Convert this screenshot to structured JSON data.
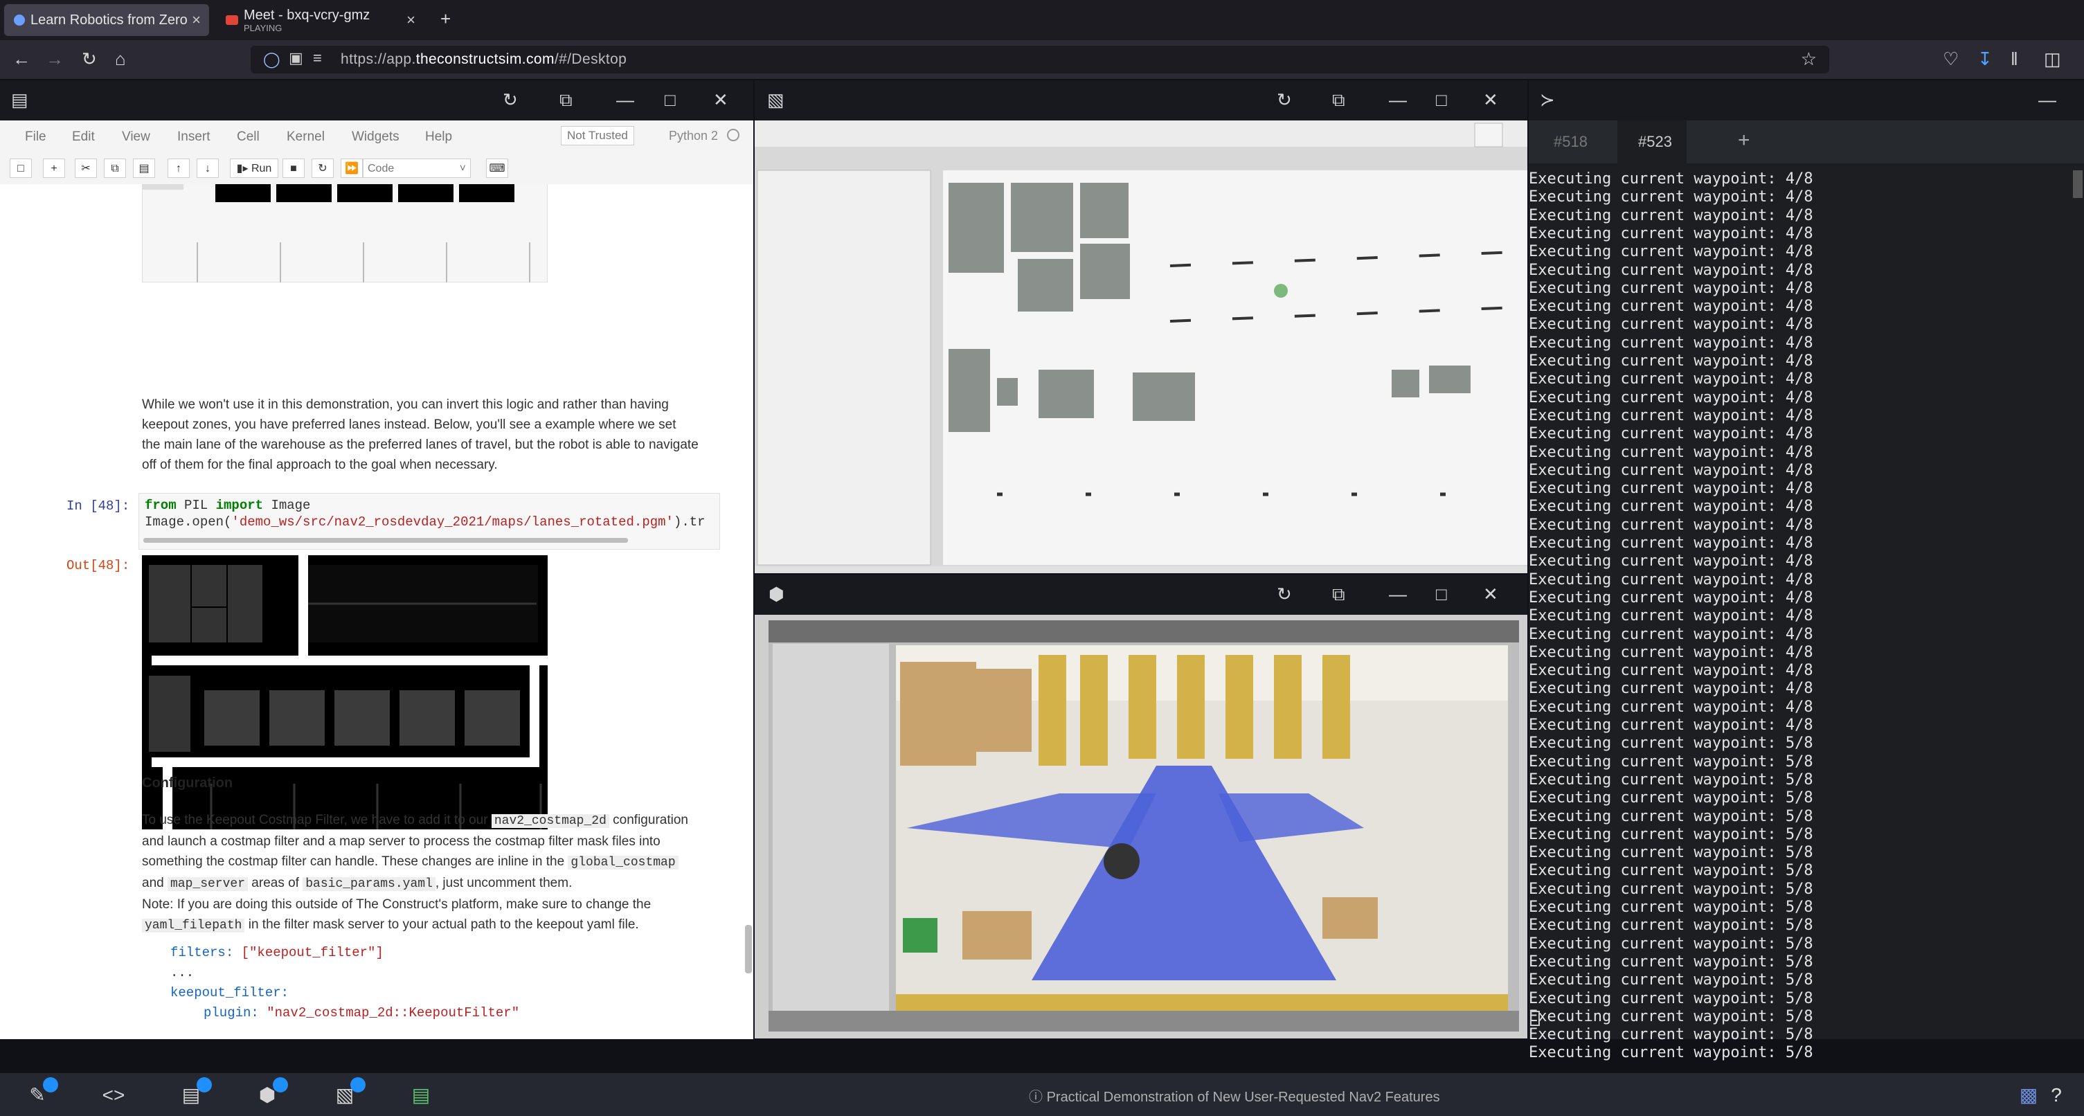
{
  "browser": {
    "tabs": [
      {
        "title": "Learn Robotics from Zero",
        "close": "×"
      },
      {
        "title": "Meet - bxq-vcry-gmz",
        "subtitle": "PLAYING",
        "close": "×"
      }
    ],
    "new_tab": "+",
    "url_prefix": "https://app.",
    "url_domain": "theconstructsim.com",
    "url_suffix": "/#/Desktop"
  },
  "jupyter": {
    "menu": [
      "File",
      "Edit",
      "View",
      "Insert",
      "Cell",
      "Kernel",
      "Widgets",
      "Help"
    ],
    "trust_label": "Not Trusted",
    "kernel_label": "Python 2",
    "run_label": "Run",
    "cell_type": "Code",
    "para1": [
      "While we won't use it in this demonstration, you can invert this logic and rather than having",
      "keepout zones, you have preferred lanes instead. Below, you'll see a example where we set",
      "the main lane of the warehouse as the preferred lanes of travel, but the robot is able to navigate",
      "off of them for the final approach to the goal when necessary."
    ],
    "in_prompt": "In [48]:",
    "out_prompt": "Out[48]:",
    "code_line1_kw1": "from",
    "code_line1_mid": " PIL ",
    "code_line1_kw2": "import",
    "code_line1_end": " Image",
    "code_line2_start": "Image.open(",
    "code_line2_str": "'demo_ws/src/nav2_rosdevday_2021/maps/lanes_rotated.pgm'",
    "code_line2_end": ").tr",
    "config_heading": "Configuration",
    "para2_a": "To use the Keepout Costmap Filter, we have to add it to our",
    "para2_code1": "nav2_costmap_2d",
    "para2_b": "configuration",
    "para2_line2": "and launch a costmap filter and a map server to process the costmap filter mask files into",
    "para2_c": "something the costmap filter can handle. These changes are inline in the",
    "para2_code2": "global_costmap",
    "para2_d": "and",
    "para2_code3": "map_server",
    "para2_e": "areas of",
    "para2_code4": "basic_params.yaml",
    "para2_f": ", just uncomment them.",
    "note_a": "Note: If you are doing this outside of The Construct's platform, make sure to change the",
    "note_code": "yaml_filepath",
    "note_b": "in the filter mask server to your actual path to the keepout yaml file.",
    "yaml_line1_key": "filters:",
    "yaml_line1_val": " [\"keepout_filter\"]",
    "yaml_line2": "...",
    "yaml_line3": "keepout_filter:",
    "yaml_line4_key": "plugin:",
    "yaml_line4_val": " \"nav2_costmap_2d::KeepoutFilter\""
  },
  "terminal": {
    "tabs": [
      "#518",
      "#523"
    ],
    "add_tab": "+",
    "lines": [
      "Executing current waypoint: 4/8",
      "Executing current waypoint: 4/8",
      "Executing current waypoint: 4/8",
      "Executing current waypoint: 4/8",
      "Executing current waypoint: 4/8",
      "Executing current waypoint: 4/8",
      "Executing current waypoint: 4/8",
      "Executing current waypoint: 4/8",
      "Executing current waypoint: 4/8",
      "Executing current waypoint: 4/8",
      "Executing current waypoint: 4/8",
      "Executing current waypoint: 4/8",
      "Executing current waypoint: 4/8",
      "Executing current waypoint: 4/8",
      "Executing current waypoint: 4/8",
      "Executing current waypoint: 4/8",
      "Executing current waypoint: 4/8",
      "Executing current waypoint: 4/8",
      "Executing current waypoint: 4/8",
      "Executing current waypoint: 4/8",
      "Executing current waypoint: 4/8",
      "Executing current waypoint: 4/8",
      "Executing current waypoint: 4/8",
      "Executing current waypoint: 4/8",
      "Executing current waypoint: 4/8",
      "Executing current waypoint: 4/8",
      "Executing current waypoint: 4/8",
      "Executing current waypoint: 4/8",
      "Executing current waypoint: 4/8",
      "Executing current waypoint: 4/8",
      "Executing current waypoint: 4/8",
      "Executing current waypoint: 5/8",
      "Executing current waypoint: 5/8",
      "Executing current waypoint: 5/8",
      "Executing current waypoint: 5/8",
      "Executing current waypoint: 5/8",
      "Executing current waypoint: 5/8",
      "Executing current waypoint: 5/8",
      "Executing current waypoint: 5/8",
      "Executing current waypoint: 5/8",
      "Executing current waypoint: 5/8",
      "Executing current waypoint: 5/8",
      "Executing current waypoint: 5/8",
      "Executing current waypoint: 5/8",
      "Executing current waypoint: 5/8",
      "Executing current waypoint: 5/8",
      "Executing current waypoint: 5/8",
      "Executing current waypoint: 5/8",
      "Executing current waypoint: 5/8"
    ]
  },
  "taskbar": {
    "status_text": "Practical Demonstration of New User-Requested Nav2 Features",
    "help": "?"
  }
}
